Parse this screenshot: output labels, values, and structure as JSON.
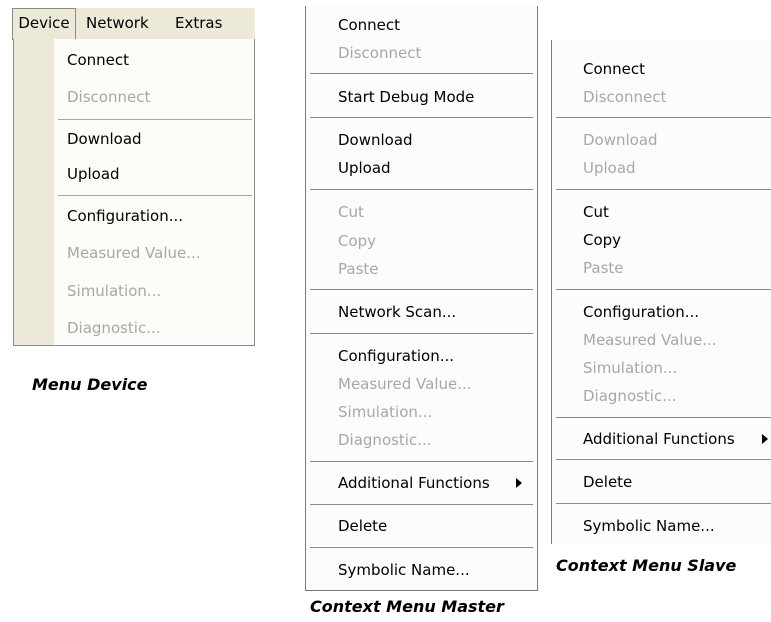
{
  "menubar": {
    "items": [
      "Device",
      "Network",
      "Extras"
    ]
  },
  "device_menu": {
    "items": [
      {
        "label": "Connect",
        "enabled": true
      },
      {
        "label": "Disconnect",
        "enabled": false
      },
      {
        "label": "Download",
        "enabled": true
      },
      {
        "label": "Upload",
        "enabled": true
      },
      {
        "label": "Configuration...",
        "enabled": true
      },
      {
        "label": "Measured Value...",
        "enabled": false
      },
      {
        "label": "Simulation...",
        "enabled": false
      },
      {
        "label": "Diagnostic...",
        "enabled": false
      }
    ],
    "caption": "Menu Device"
  },
  "master_menu": {
    "items": [
      {
        "label": "Connect",
        "enabled": true
      },
      {
        "label": "Disconnect",
        "enabled": false
      },
      {
        "label": "Start Debug Mode",
        "enabled": true
      },
      {
        "label": "Download",
        "enabled": true
      },
      {
        "label": "Upload",
        "enabled": true
      },
      {
        "label": "Cut",
        "enabled": false
      },
      {
        "label": "Copy",
        "enabled": false
      },
      {
        "label": "Paste",
        "enabled": false
      },
      {
        "label": "Network Scan...",
        "enabled": true
      },
      {
        "label": "Configuration...",
        "enabled": true
      },
      {
        "label": "Measured Value...",
        "enabled": false
      },
      {
        "label": "Simulation...",
        "enabled": false
      },
      {
        "label": "Diagnostic...",
        "enabled": false
      },
      {
        "label": "Additional Functions",
        "enabled": true,
        "submenu": true
      },
      {
        "label": "Delete",
        "enabled": true
      },
      {
        "label": "Symbolic Name...",
        "enabled": true
      }
    ],
    "caption": "Context Menu Master"
  },
  "slave_menu": {
    "items": [
      {
        "label": "Connect",
        "enabled": true
      },
      {
        "label": "Disconnect",
        "enabled": false
      },
      {
        "label": "Download",
        "enabled": false
      },
      {
        "label": "Upload",
        "enabled": false
      },
      {
        "label": "Cut",
        "enabled": true
      },
      {
        "label": "Copy",
        "enabled": true
      },
      {
        "label": "Paste",
        "enabled": false
      },
      {
        "label": "Configuration...",
        "enabled": true
      },
      {
        "label": "Measured Value...",
        "enabled": false
      },
      {
        "label": "Simulation...",
        "enabled": false
      },
      {
        "label": "Diagnostic...",
        "enabled": false
      },
      {
        "label": "Additional Functions",
        "enabled": true,
        "submenu": true
      },
      {
        "label": "Delete",
        "enabled": true
      },
      {
        "label": "Symbolic Name...",
        "enabled": true
      }
    ],
    "caption": "Context Menu Slave"
  },
  "colors": {
    "menubar_bg": "#ece9d8",
    "disabled_text": "#a7a7a7",
    "menu_bg": "#fcfcfc"
  }
}
